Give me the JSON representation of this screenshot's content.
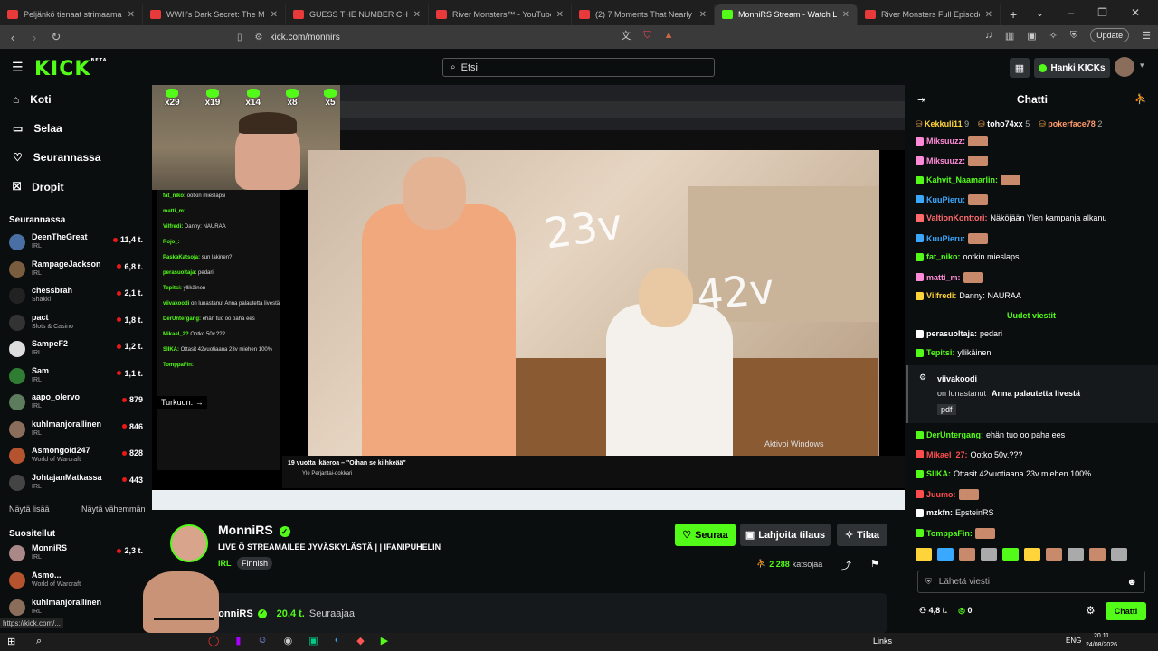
{
  "browser": {
    "tabs": [
      {
        "title": "Peljänkö tienaat strimaamalla? - La...",
        "color": "#e83a3a",
        "active": false
      },
      {
        "title": "WWII's Dark Secret: The Massacre of...",
        "color": "#e83a3a",
        "active": false
      },
      {
        "title": "GUESS THE NUMBER CHALLENGE!",
        "color": "#e83a3a",
        "active": false
      },
      {
        "title": "River Monsters™ - YouTube",
        "color": "#e83a3a",
        "active": false
      },
      {
        "title": "(2) 7 Moments That Nearly Ended in...",
        "color": "#e83a3a",
        "active": false
      },
      {
        "title": "MonniRS Stream - Watch Li...",
        "color": "#53fc18",
        "active": true
      },
      {
        "title": "River Monsters Full Episode - South...",
        "color": "#e83a3a",
        "active": false
      }
    ],
    "new_tab": "+",
    "url": "kick.com/monnirs",
    "update_label": "Update"
  },
  "kick": {
    "logo": "KICK",
    "logo_sup": "BETA",
    "search_placeholder": "Etsi",
    "get_kicks": "Hanki KICKs"
  },
  "sidebar": {
    "nav": [
      {
        "label": "Koti",
        "icon": "home-icon"
      },
      {
        "label": "Selaa",
        "icon": "browse-icon"
      },
      {
        "label": "Seurannassa",
        "icon": "heart-icon"
      },
      {
        "label": "Dropit",
        "icon": "gift-icon"
      }
    ],
    "following_title": "Seurannassa",
    "following": [
      {
        "name": "DeenTheGreat",
        "category": "IRL",
        "viewers": "11,4 t.",
        "color": "#4a6fa5"
      },
      {
        "name": "RampageJackson",
        "category": "IRL",
        "viewers": "6,8 t.",
        "color": "#7a5c3e"
      },
      {
        "name": "chessbrah",
        "category": "Shakki",
        "viewers": "2,1 t.",
        "color": "#222"
      },
      {
        "name": "pact",
        "category": "Slots & Casino",
        "viewers": "1,8 t.",
        "color": "#333"
      },
      {
        "name": "SampeF2",
        "category": "IRL",
        "viewers": "1,2 t.",
        "color": "#ddd"
      },
      {
        "name": "Sam",
        "category": "IRL",
        "viewers": "1,1 t.",
        "color": "#2e7d32"
      },
      {
        "name": "aapo_olervo",
        "category": "IRL",
        "viewers": "879",
        "color": "#5d7b5d"
      },
      {
        "name": "kuhlmanjorallinen",
        "category": "IRL",
        "viewers": "846",
        "color": "#8a6d5b"
      },
      {
        "name": "Asmongold247",
        "category": "World of Warcraft",
        "viewers": "828",
        "color": "#b5532f"
      },
      {
        "name": "JohtajanMatkassa",
        "category": "IRL",
        "viewers": "443",
        "color": "#444"
      }
    ],
    "show_more": "Näytä lisää",
    "show_less": "Näytä vähemmän",
    "recommended_title": "Suositellut",
    "recommended": [
      {
        "name": "MonniRS",
        "category": "IRL",
        "viewers": "2,3 t.",
        "color": "#a88"
      },
      {
        "name": "Asmo...",
        "category": "World of Warcraft",
        "viewers": "",
        "color": "#b5532f"
      },
      {
        "name": "kuhlmanjorallinen",
        "category": "IRL",
        "viewers": "",
        "color": "#8a6d5b"
      }
    ],
    "status_url": "https://kick.com/..."
  },
  "video": {
    "overlay_counters": [
      "x29",
      "x19",
      "x14",
      "x8",
      "x5"
    ],
    "text_23": "23v",
    "text_42": "42v",
    "stream_chat_lines": [
      {
        "user": "fat_niko:",
        "text": "ootkin mieslapsi"
      },
      {
        "user": "matti_m:",
        "text": ""
      },
      {
        "user": "Vilfredi:",
        "text": "Danny: NAURAA"
      },
      {
        "user": "Rojo_:",
        "text": ""
      },
      {
        "user": "PaskaKatsoja:",
        "text": "sun lakinen?"
      },
      {
        "user": "perasuoltaja:",
        "text": "pedari"
      },
      {
        "user": "Tepitsi:",
        "text": "yllikäinen"
      },
      {
        "user": "viivakoodi",
        "text": "on lunastanut Anna palautetta livestä"
      },
      {
        "user": "DerUntergang:",
        "text": "ehän tuo oo paha ees"
      },
      {
        "user": "Mikael_2?",
        "text": "Ootko 50v.???"
      },
      {
        "user": "SIIKA:",
        "text": "Ottasit 42vuotiaana 23v miehen 100%"
      },
      {
        "user": "TomppaFin:",
        "text": ""
      }
    ],
    "turku_label": "Turkuun.",
    "inner_video_title": "19 vuotta ikäeroa – \"Oihan se kiihkeää\"",
    "inner_channel": "Yle Perjantai-dokkari",
    "watermark": "Aktivoi Windows"
  },
  "stream_info": {
    "channel": "MonniRS",
    "title": "LIVE Ö STREAMAILEE JYVÄSKYLÄSTÄ | | IFANIPUHELIN",
    "category": "IRL",
    "tag": "Finnish",
    "follow": "Seuraa",
    "gift": "Lahjoita tilaus",
    "subscribe": "Tilaa",
    "viewer_count": "2 288",
    "viewer_label": "katsojaa",
    "about_name": "MonniRS",
    "followers": "20,4 t.",
    "followers_label": "Seuraajaa"
  },
  "chat": {
    "title": "Chatti",
    "top_line": [
      {
        "user": "Kekkuli11",
        "count": "9"
      },
      {
        "user": "toho74xx",
        "count": "5"
      },
      {
        "user": "pokerface78",
        "count": "2"
      }
    ],
    "messages": [
      {
        "user": "Miksuuzz:",
        "text": "",
        "color": "#ff8ad8"
      },
      {
        "user": "Miksuuzz:",
        "text": "",
        "color": "#ff8ad8"
      },
      {
        "user": "Kahvit_Naamarlin:",
        "text": "",
        "color": "#53fc18"
      },
      {
        "user": "KuuPieru:",
        "text": "",
        "color": "#3aa8ff"
      },
      {
        "user": "ValtionKonttori:",
        "text": "Näköjään Ylen kampanja alkanu",
        "color": "#ff6b6b"
      },
      {
        "user": "KuuPieru:",
        "text": "",
        "color": "#3aa8ff"
      },
      {
        "user": "fat_niko:",
        "text": "ootkin mieslapsi",
        "color": "#53fc18"
      },
      {
        "user": "matti_m:",
        "text": "",
        "color": "#ff8ad8"
      },
      {
        "user": "Vilfredi:",
        "text": "Danny: NAURAA",
        "color": "#ffd43b"
      }
    ],
    "new_messages": "Uudet viestit",
    "messages2": [
      {
        "user": "perasuoltaja:",
        "text": "pedari",
        "color": "#fff"
      },
      {
        "user": "Tepitsi:",
        "text": "yllikäinen",
        "color": "#53fc18"
      }
    ],
    "redeem_user": "viivakoodi",
    "redeem_text": "on lunastanut",
    "redeem_reward": "Anna palautetta livestä",
    "redeem_extra": "pdf",
    "messages3": [
      {
        "user": "DerUntergang:",
        "text": "ehän tuo oo paha ees",
        "color": "#53fc18"
      },
      {
        "user": "Mikael_27:",
        "text": "Ootko 50v.???",
        "color": "#ff4d4d"
      },
      {
        "user": "SIIKA:",
        "text": "Ottasit 42vuotiaana 23v miehen 100%",
        "color": "#53fc18"
      },
      {
        "user": "Juumo:",
        "text": "",
        "color": "#ff4d4d"
      },
      {
        "user": "mzkfn:",
        "text": "EpsteinRS",
        "color": "#fff"
      },
      {
        "user": "TomppaFin:",
        "text": "",
        "color": "#53fc18"
      }
    ],
    "input_placeholder": "Lähetä viesti",
    "kicks_count": "4,8 t.",
    "zero": "0",
    "send": "Chatti"
  },
  "taskbar": {
    "links": "Links",
    "lang": "ENG",
    "time": "20.11",
    "date": "24/08/2026"
  }
}
